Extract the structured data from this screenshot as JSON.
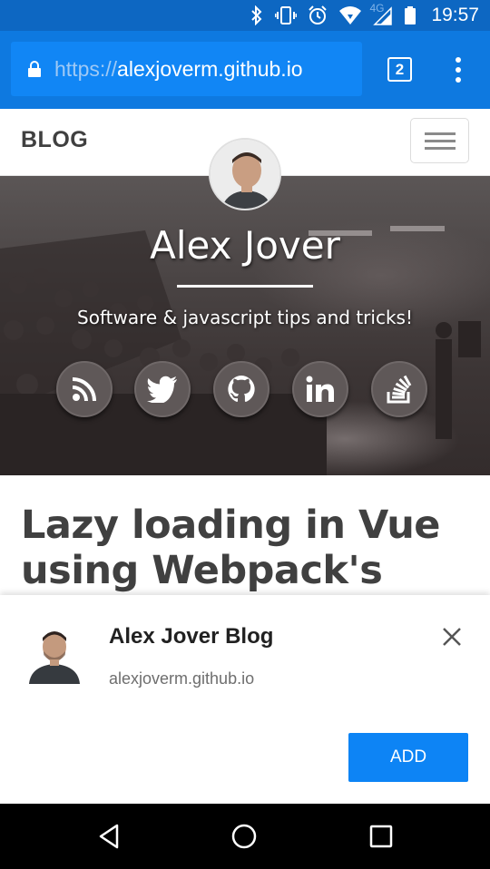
{
  "status_bar": {
    "time": "19:57",
    "network_label": "4G",
    "icons": [
      "bluetooth-icon",
      "vibrate-icon",
      "alarm-icon",
      "wifi-icon",
      "signal-icon",
      "battery-icon"
    ]
  },
  "browser": {
    "url_scheme": "https://",
    "url_host": "alexjoverm.github.io",
    "tab_count": "2",
    "menu_icon": "more-vert-icon",
    "lock_icon": "lock-icon"
  },
  "site_nav": {
    "brand": "BLOG",
    "menu_icon": "hamburger-icon"
  },
  "hero": {
    "name": "Alex Jover",
    "subtitle": "Software & javascript tips and tricks!",
    "social_links": [
      {
        "name": "rss-icon"
      },
      {
        "name": "twitter-icon"
      },
      {
        "name": "github-icon"
      },
      {
        "name": "linkedin-icon"
      },
      {
        "name": "stackoverflow-icon"
      }
    ]
  },
  "article": {
    "title_line1": "Lazy loading in Vue",
    "title_line2": "using Webpack's code"
  },
  "install_banner": {
    "app_name": "Alex Jover Blog",
    "app_url": "alexjoverm.github.io",
    "add_label": "ADD",
    "close_icon": "close-icon"
  },
  "nav_bar": {
    "buttons": [
      "back-icon",
      "home-icon",
      "recents-icon"
    ]
  },
  "colors": {
    "status_bar": "#0d67c2",
    "toolbar": "#0e79e0",
    "add_button": "#0d84f5",
    "text_dark": "#404040"
  }
}
